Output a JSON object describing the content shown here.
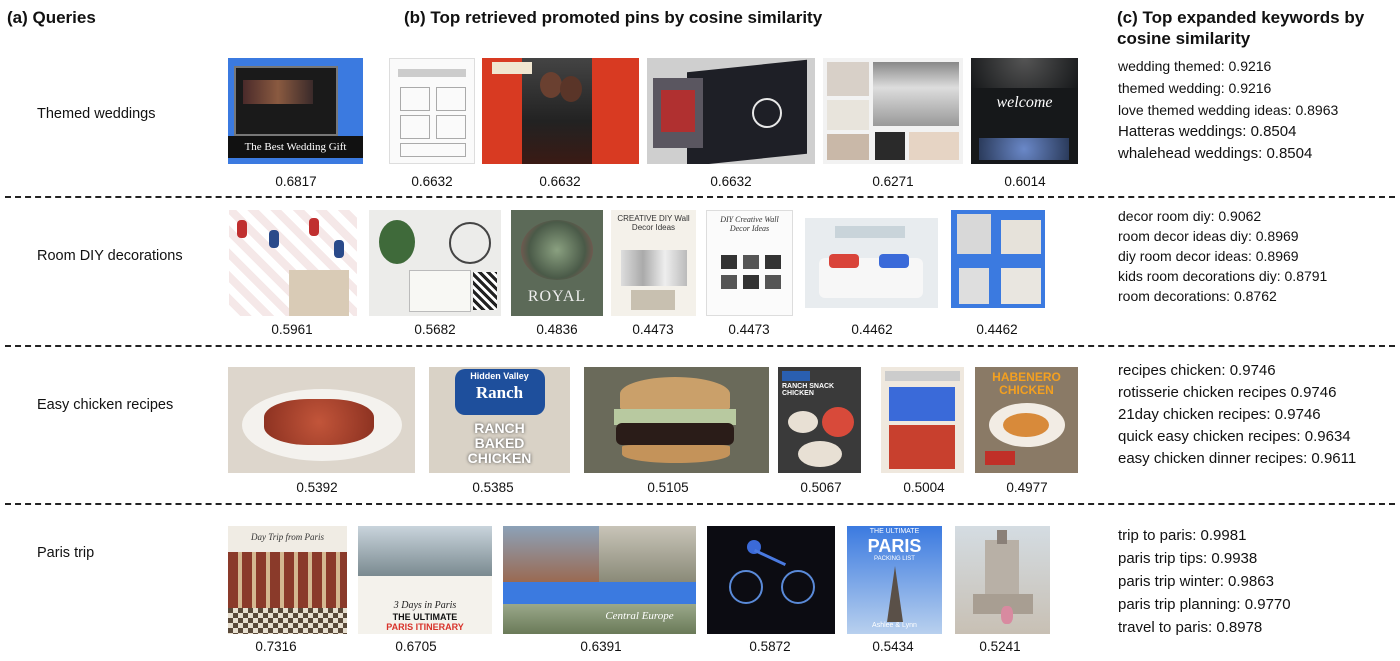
{
  "headers": {
    "queries": "(a) Queries",
    "pins": "(b) Top retrieved promoted pins by cosine similarity",
    "keywords": "(c) Top expanded keywords by cosine similarity"
  },
  "rows": [
    {
      "query": "Themed weddings",
      "scores": [
        "0.6817",
        "0.6632",
        "0.6632",
        "0.6632",
        "0.6271",
        "0.6014"
      ],
      "keywords": [
        "wedding themed: 0.9216",
        "themed wedding: 0.9216",
        "love themed wedding ideas: 0.8963",
        "Hatteras weddings: 0.8504",
        "whalehead weddings: 0.8504"
      ],
      "pin_text": {
        "p1": "The Best Wedding Gift",
        "p6": "welcome"
      }
    },
    {
      "query": "Room DIY decorations",
      "scores": [
        "0.5961",
        "0.5682",
        "0.4836",
        "0.4473",
        "0.4473",
        "0.4462",
        "0.4462"
      ],
      "keywords": [
        "decor room diy: 0.9062",
        "room decor ideas diy: 0.8969",
        "diy room decor ideas: 0.8969",
        "kids room decorations diy: 0.8791",
        "room decorations: 0.8762"
      ],
      "pin_text": {
        "p3": "ROYAL",
        "p4": "CREATIVE DIY Wall Decor Ideas",
        "p5": "DIY Creative Wall Decor Ideas"
      }
    },
    {
      "query": "Easy chicken recipes",
      "scores": [
        "0.5392",
        "0.5385",
        "0.5105",
        "0.5067",
        "0.5004",
        "0.4977"
      ],
      "keywords": [
        "recipes chicken: 0.9746",
        "rotisserie chicken recipes 0.9746",
        "21day chicken recipes: 0.9746",
        "quick easy chicken recipes: 0.9634",
        "easy chicken dinner recipes: 0.9611"
      ],
      "pin_text": {
        "p2a": "Hidden Valley",
        "p2b": "Ranch",
        "p2c": "RANCH BAKED CHICKEN",
        "p4": "RANCH SNACK CHICKEN",
        "p6": "HABENERO CHICKEN"
      }
    },
    {
      "query": "Paris trip",
      "scores": [
        "0.7316",
        "0.6705",
        "0.6391",
        "0.5872",
        "0.5434",
        "0.5241"
      ],
      "keywords": [
        "trip to paris: 0.9981",
        "paris trip tips: 0.9938",
        "paris trip winter: 0.9863",
        "paris trip planning: 0.9770",
        "travel to paris: 0.8978"
      ],
      "pin_text": {
        "p1": "Day Trip from Paris",
        "p2a": "3 Days in Paris",
        "p2b": "THE ULTIMATE",
        "p2c": "PARIS ITINERARY",
        "p3": "Central Europe",
        "p5a": "THE ULTIMATE",
        "p5b": "PARIS",
        "p5c": "PACKING LIST",
        "p5d": "Ashlee & Lynn"
      }
    }
  ],
  "colors": {
    "accent_blue": "#3a78d8",
    "accent_red": "#e04a2c"
  }
}
